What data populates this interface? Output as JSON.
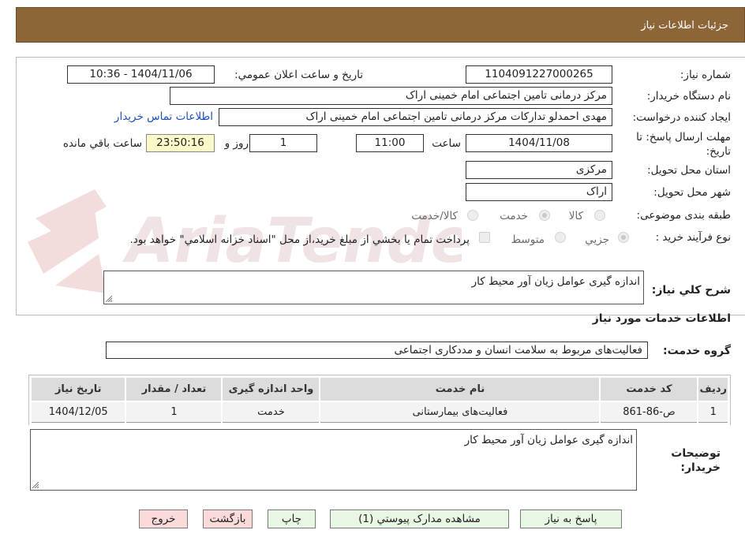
{
  "header": {
    "title": "جزئيات اطلاعات نياز"
  },
  "form": {
    "need_number": {
      "label": "شماره نياز:",
      "value": "1104091227000265"
    },
    "announce": {
      "label": "تاريخ و ساعت اعلان عمومي:",
      "value": "1404/11/06 - 10:36"
    },
    "buyer_org": {
      "label": "نام دستگاه خريدار:",
      "value": "مرکز درمانی تامین اجتماعی امام خمینی اراک"
    },
    "requester": {
      "label": "ايجاد کننده درخواست:",
      "value": "مهدی احمدلو تدارکات مرکز درمانی تامین اجتماعی امام خمینی اراک"
    },
    "contact_link": "اطلاعات تماس خريدار",
    "deadline": {
      "label_line1": "مهلت ارسال پاسخ: تا",
      "label_line2": "تاريخ:",
      "date": "1404/11/08",
      "time_label": "ساعت",
      "time": "11:00",
      "days": "1",
      "days_label": "روز و",
      "remaining": "23:50:16",
      "remaining_label": "ساعت باقي مانده"
    },
    "province": {
      "label": "استان محل تحويل:",
      "value": "مرکزی"
    },
    "city": {
      "label": "شهر محل تحويل:",
      "value": "اراک"
    },
    "category": {
      "label": "طبقه بندی موضوعی:",
      "options": [
        "کالا",
        "خدمت",
        "کالا/خدمت"
      ],
      "selected": "خدمت"
    },
    "process": {
      "label": "نوع فرآيند خريد :",
      "options": [
        "جزيي",
        "متوسط"
      ],
      "selected": "جزيي",
      "payment_note": "پرداخت تمام يا بخشي از مبلغ خريد،از محل \"اسناد خزانه اسلامي\" خواهد بود."
    },
    "description": {
      "label": "شرح کلي نياز:",
      "value": "اندازه گیری عوامل زیان آور محیط کار"
    }
  },
  "services": {
    "section_title": "اطلاعات خدمات مورد نياز",
    "group_label": "گروه خدمت:",
    "group_value": "فعاليت‌های مربوط به سلامت انسان و مددکاری اجتماعی",
    "columns": [
      "رديف",
      "کد خدمت",
      "نام خدمت",
      "واحد اندازه گيری",
      "تعداد / مقدار",
      "تاريخ نياز"
    ],
    "rows": [
      [
        "1",
        "ص-86-861",
        "فعالیت‌های بیمارستانی",
        "خدمت",
        "1",
        "1404/12/05"
      ]
    ]
  },
  "buyer_notes": {
    "label_line1": "توضيحات",
    "label_line2": "خريدار:",
    "value": "اندازه گیری عوامل زیان آور محیط کار"
  },
  "buttons": {
    "reply": "پاسخ به نياز",
    "attachments": "مشاهده مدارک پيوستي (1)",
    "print": "چاپ",
    "back": "بازگشت",
    "exit": "خروج"
  },
  "colors": {
    "header_bg": "#8d6537",
    "link": "#1c4fc0",
    "button_green": "#e8f7e4",
    "button_pink": "#fbdada"
  },
  "watermark": {
    "text": "AriaTender.neT"
  }
}
